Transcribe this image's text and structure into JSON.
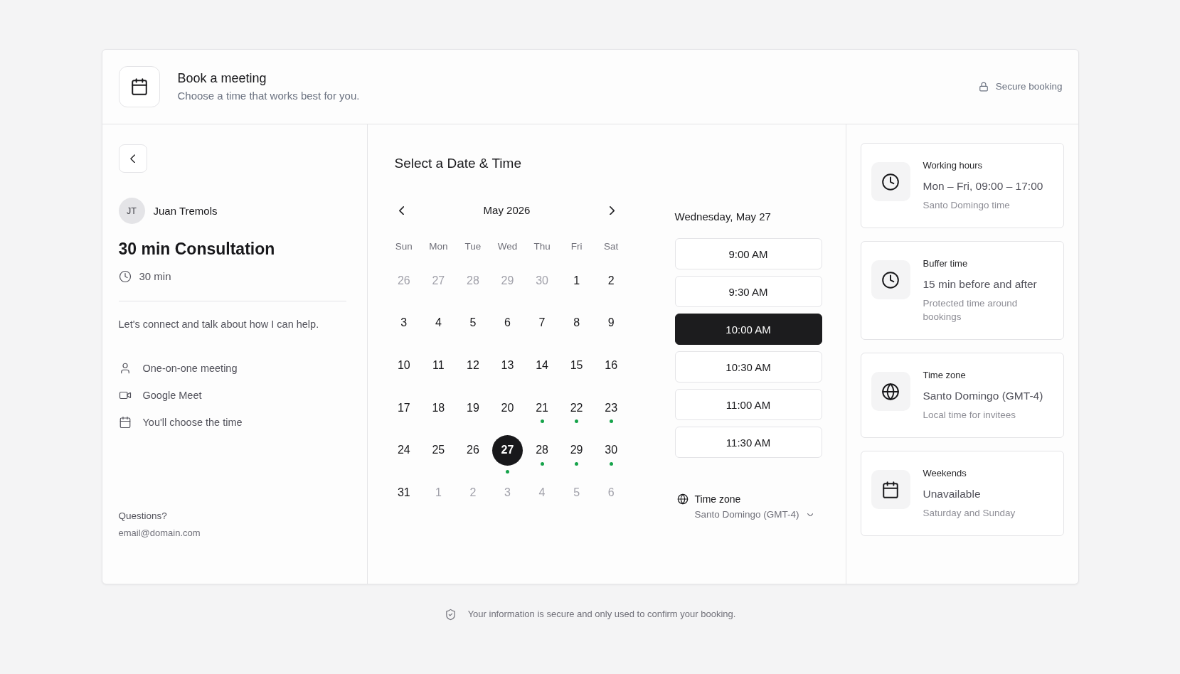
{
  "header": {
    "title": "Book a meeting",
    "subtitle": "Choose a time that works best for you.",
    "note": "Secure booking"
  },
  "event": {
    "host_initials": "JT",
    "host_name": "Juan Tremols",
    "title": "30 min Consultation",
    "duration": "30 min",
    "description": "Let's connect and talk about how I can help.",
    "details": [
      {
        "kind": "person",
        "text": "One-on-one meeting"
      },
      {
        "kind": "video",
        "text": "Google Meet"
      },
      {
        "kind": "calendar",
        "text": "You'll choose the time"
      }
    ],
    "contact_label": "Questions?",
    "contact_email": "email@domain.com"
  },
  "scheduler": {
    "title": "Select a Date & Time",
    "month": "May 2026",
    "weekdays": [
      "Sun",
      "Mon",
      "Tue",
      "Wed",
      "Thu",
      "Fri",
      "Sat"
    ],
    "days": [
      {
        "label": "26",
        "in_month": false,
        "available": false,
        "selected": false
      },
      {
        "label": "27",
        "in_month": false,
        "available": false,
        "selected": false
      },
      {
        "label": "28",
        "in_month": false,
        "available": false,
        "selected": false
      },
      {
        "label": "29",
        "in_month": false,
        "available": false,
        "selected": false
      },
      {
        "label": "30",
        "in_month": false,
        "available": false,
        "selected": false
      },
      {
        "label": "1",
        "in_month": true,
        "available": false,
        "selected": false
      },
      {
        "label": "2",
        "in_month": true,
        "available": false,
        "selected": false
      },
      {
        "label": "3",
        "in_month": true,
        "available": false,
        "selected": false
      },
      {
        "label": "4",
        "in_month": true,
        "available": false,
        "selected": false
      },
      {
        "label": "5",
        "in_month": true,
        "available": false,
        "selected": false
      },
      {
        "label": "6",
        "in_month": true,
        "available": false,
        "selected": false
      },
      {
        "label": "7",
        "in_month": true,
        "available": false,
        "selected": false
      },
      {
        "label": "8",
        "in_month": true,
        "available": false,
        "selected": false
      },
      {
        "label": "9",
        "in_month": true,
        "available": false,
        "selected": false
      },
      {
        "label": "10",
        "in_month": true,
        "available": false,
        "selected": false
      },
      {
        "label": "11",
        "in_month": true,
        "available": false,
        "selected": false
      },
      {
        "label": "12",
        "in_month": true,
        "available": false,
        "selected": false
      },
      {
        "label": "13",
        "in_month": true,
        "available": false,
        "selected": false
      },
      {
        "label": "14",
        "in_month": true,
        "available": false,
        "selected": false
      },
      {
        "label": "15",
        "in_month": true,
        "available": false,
        "selected": false
      },
      {
        "label": "16",
        "in_month": true,
        "available": false,
        "selected": false
      },
      {
        "label": "17",
        "in_month": true,
        "available": false,
        "selected": false
      },
      {
        "label": "18",
        "in_month": true,
        "available": false,
        "selected": false
      },
      {
        "label": "19",
        "in_month": true,
        "available": false,
        "selected": false
      },
      {
        "label": "20",
        "in_month": true,
        "available": false,
        "selected": false
      },
      {
        "label": "21",
        "in_month": true,
        "available": true,
        "selected": false
      },
      {
        "label": "22",
        "in_month": true,
        "available": true,
        "selected": false
      },
      {
        "label": "23",
        "in_month": true,
        "available": true,
        "selected": false
      },
      {
        "label": "24",
        "in_month": true,
        "available": false,
        "selected": false
      },
      {
        "label": "25",
        "in_month": true,
        "available": false,
        "selected": false
      },
      {
        "label": "26",
        "in_month": true,
        "available": false,
        "selected": false
      },
      {
        "label": "27",
        "in_month": true,
        "available": true,
        "selected": true
      },
      {
        "label": "28",
        "in_month": true,
        "available": true,
        "selected": false
      },
      {
        "label": "29",
        "in_month": true,
        "available": true,
        "selected": false
      },
      {
        "label": "30",
        "in_month": true,
        "available": true,
        "selected": false
      },
      {
        "label": "31",
        "in_month": true,
        "available": false,
        "selected": false
      },
      {
        "label": "1",
        "in_month": false,
        "available": false,
        "selected": false
      },
      {
        "label": "2",
        "in_month": false,
        "available": false,
        "selected": false
      },
      {
        "label": "3",
        "in_month": false,
        "available": false,
        "selected": false
      },
      {
        "label": "4",
        "in_month": false,
        "available": false,
        "selected": false
      },
      {
        "label": "5",
        "in_month": false,
        "available": false,
        "selected": false
      },
      {
        "label": "6",
        "in_month": false,
        "available": false,
        "selected": false
      }
    ],
    "date_heading": "Wednesday, May 27",
    "slots": [
      {
        "label": "9:00 AM",
        "selected": false
      },
      {
        "label": "9:30 AM",
        "selected": false
      },
      {
        "label": "10:00 AM",
        "selected": true
      },
      {
        "label": "10:30 AM",
        "selected": false
      },
      {
        "label": "11:00 AM",
        "selected": false
      },
      {
        "label": "11:30 AM",
        "selected": false
      }
    ],
    "timezone": {
      "label": "Time zone",
      "value": "Santo Domingo (GMT-4)"
    }
  },
  "info_cards": [
    {
      "kind": "clock",
      "title": "Working hours",
      "value": "Mon – Fri, 09:00 – 17:00",
      "note": "Santo Domingo time"
    },
    {
      "kind": "clock",
      "title": "Buffer time",
      "value": "15 min before and after",
      "note": "Protected time around bookings"
    },
    {
      "kind": "globe",
      "title": "Time zone",
      "value": "Santo Domingo (GMT-4)",
      "note": "Local time for invitees"
    },
    {
      "kind": "calendar",
      "title": "Weekends",
      "value": "Unavailable",
      "note": "Saturday and Sunday"
    }
  ],
  "footer": "Your information is secure and only used to confirm your booking."
}
